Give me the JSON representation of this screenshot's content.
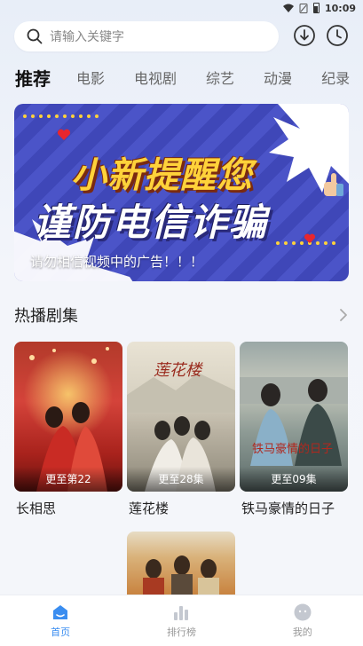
{
  "status": {
    "time": "10:09"
  },
  "search": {
    "placeholder": "请输入关键字"
  },
  "tabs": [
    {
      "label": "推荐",
      "active": true
    },
    {
      "label": "电影"
    },
    {
      "label": "电视剧"
    },
    {
      "label": "综艺"
    },
    {
      "label": "动漫"
    },
    {
      "label": "纪录"
    }
  ],
  "banner": {
    "title_line1": "小新提醒您",
    "title_line2": "谨防电信诈骗",
    "caption": "请勿相信视频中的广告！！！"
  },
  "section": {
    "title": "热播剧集"
  },
  "dramas": [
    {
      "name": "长相思",
      "status": "更至第22"
    },
    {
      "name": "莲花楼",
      "status": "更至28集"
    },
    {
      "name": "铁马豪情的日子",
      "status": "更至09集"
    }
  ],
  "nav": [
    {
      "label": "首页",
      "active": true
    },
    {
      "label": "排行榜"
    },
    {
      "label": "我的"
    }
  ],
  "colors": {
    "accent": "#3a8df0",
    "banner_bg": "#4149bb",
    "banner_yellow": "#ffd23a"
  }
}
